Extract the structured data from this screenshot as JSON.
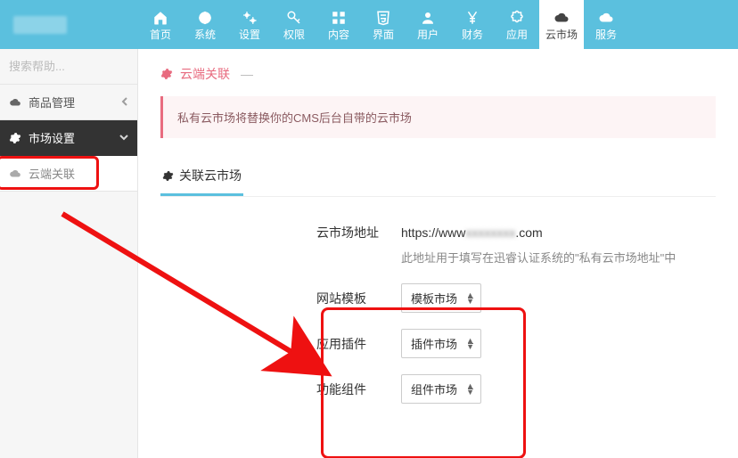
{
  "nav": [
    {
      "icon": "home",
      "label": "首页"
    },
    {
      "icon": "globe",
      "label": "系统"
    },
    {
      "icon": "cogs",
      "label": "设置"
    },
    {
      "icon": "key",
      "label": "权限"
    },
    {
      "icon": "grid",
      "label": "内容"
    },
    {
      "icon": "html5",
      "label": "界面"
    },
    {
      "icon": "user",
      "label": "用户"
    },
    {
      "icon": "yen",
      "label": "财务"
    },
    {
      "icon": "puzzle",
      "label": "应用"
    },
    {
      "icon": "cloud",
      "label": "云市场",
      "active": true
    },
    {
      "icon": "cloud",
      "label": "服务"
    }
  ],
  "search": {
    "placeholder": "搜索帮助..."
  },
  "sidebar": {
    "items": [
      {
        "icon": "cloud",
        "label": "商品管理",
        "chev": "‹"
      },
      {
        "icon": "gear",
        "label": "市场设置",
        "chev": "⌄",
        "dark": true
      },
      {
        "icon": "cloud",
        "label": "云端关联",
        "sub": true
      }
    ]
  },
  "crumb": {
    "icon": "gear",
    "title": "云端关联",
    "dash": "—"
  },
  "alert": {
    "text": "私有云市场将替换你的CMS后台自带的云市场"
  },
  "tab": {
    "icon": "gear",
    "label": "关联云市场"
  },
  "form": {
    "url_label": "云市场地址",
    "url_prefix": "https://www",
    "url_suffix": ".com",
    "url_hint": "此地址用于填写在迅睿认证系统的\"私有云市场地址\"中",
    "rows": [
      {
        "label": "网站模板",
        "value": "模板市场"
      },
      {
        "label": "应用插件",
        "value": "插件市场"
      },
      {
        "label": "功能组件",
        "value": "组件市场"
      }
    ]
  }
}
